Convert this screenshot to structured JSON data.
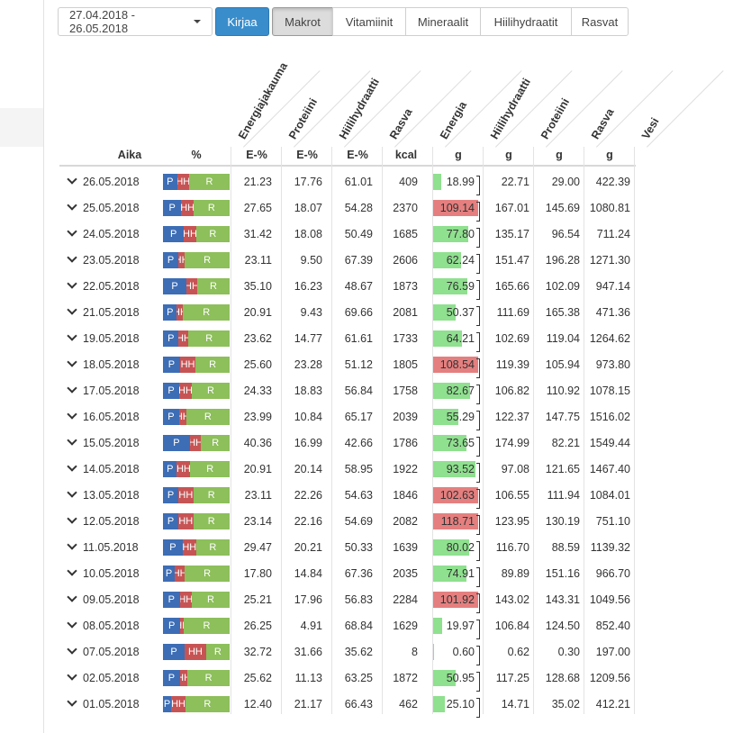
{
  "toolbar": {
    "date_range": "27.04.2018 - 26.05.2018",
    "log_button": "Kirjaa",
    "tabs": [
      "Makrot",
      "Vitamiinit",
      "Mineraalit",
      "Hiilihydraatit",
      "Rasvat"
    ],
    "active_tab": "Makrot"
  },
  "table": {
    "rotated_headers": [
      "Energiajakauma",
      "Proteiini",
      "Hiilihydraatti",
      "Rasva",
      "Energia",
      "Hiilihydraatti",
      "Proteiini",
      "Rasva",
      "Vesi"
    ],
    "units": [
      "Aika",
      "%",
      "E-%",
      "E-%",
      "E-%",
      "kcal",
      "g",
      "g",
      "g",
      "g",
      "g"
    ],
    "bar_labels": {
      "p": "P",
      "h": "HH",
      "r": "R"
    },
    "colors": {
      "protein": "#3d6db5",
      "carb": "#c75454",
      "fat": "#8dbf5b",
      "energy_ok": "#8fe08f",
      "energy_over": "#e57f7f"
    },
    "rows": [
      {
        "date": "26.05.2018",
        "p": "21.23",
        "h": "17.76",
        "r": "61.01",
        "kcal": "409",
        "energy": "18.99",
        "carb_g": "22.71",
        "protein_g": "29.00",
        "fat_g": "422.39",
        "split": [
          21.23,
          17.76,
          61.01
        ]
      },
      {
        "date": "25.05.2018",
        "p": "27.65",
        "h": "18.07",
        "r": "54.28",
        "kcal": "2370",
        "energy": "109.14",
        "carb_g": "167.01",
        "protein_g": "145.69",
        "fat_g": "1080.81",
        "split": [
          27.65,
          18.07,
          54.28
        ]
      },
      {
        "date": "24.05.2018",
        "p": "31.42",
        "h": "18.08",
        "r": "50.49",
        "kcal": "1685",
        "energy": "77.80",
        "carb_g": "135.17",
        "protein_g": "96.54",
        "fat_g": "711.24",
        "split": [
          31.42,
          18.08,
          50.49
        ]
      },
      {
        "date": "23.05.2018",
        "p": "23.11",
        "h": "9.50",
        "r": "67.39",
        "kcal": "2606",
        "energy": "62.24",
        "carb_g": "151.47",
        "protein_g": "196.28",
        "fat_g": "1271.30",
        "split": [
          23.11,
          9.5,
          67.39
        ]
      },
      {
        "date": "22.05.2018",
        "p": "35.10",
        "h": "16.23",
        "r": "48.67",
        "kcal": "1873",
        "energy": "76.59",
        "carb_g": "165.66",
        "protein_g": "102.09",
        "fat_g": "947.14",
        "split": [
          35.1,
          16.23,
          48.67
        ]
      },
      {
        "date": "21.05.2018",
        "p": "20.91",
        "h": "9.43",
        "r": "69.66",
        "kcal": "2081",
        "energy": "50.37",
        "carb_g": "111.69",
        "protein_g": "165.38",
        "fat_g": "471.36",
        "split": [
          20.91,
          9.43,
          69.66
        ]
      },
      {
        "date": "19.05.2018",
        "p": "23.62",
        "h": "14.77",
        "r": "61.61",
        "kcal": "1733",
        "energy": "64.21",
        "carb_g": "102.69",
        "protein_g": "119.04",
        "fat_g": "1264.62",
        "split": [
          23.62,
          14.77,
          61.61
        ]
      },
      {
        "date": "18.05.2018",
        "p": "25.60",
        "h": "23.28",
        "r": "51.12",
        "kcal": "1805",
        "energy": "108.54",
        "carb_g": "119.39",
        "protein_g": "105.94",
        "fat_g": "973.80",
        "split": [
          25.6,
          23.28,
          51.12
        ]
      },
      {
        "date": "17.05.2018",
        "p": "24.33",
        "h": "18.83",
        "r": "56.84",
        "kcal": "1758",
        "energy": "82.67",
        "carb_g": "106.82",
        "protein_g": "110.92",
        "fat_g": "1078.15",
        "split": [
          24.33,
          18.83,
          56.84
        ]
      },
      {
        "date": "16.05.2018",
        "p": "23.99",
        "h": "10.84",
        "r": "65.17",
        "kcal": "2039",
        "energy": "55.29",
        "carb_g": "122.37",
        "protein_g": "147.75",
        "fat_g": "1516.02",
        "split": [
          23.99,
          10.84,
          65.17
        ]
      },
      {
        "date": "15.05.2018",
        "p": "40.36",
        "h": "16.99",
        "r": "42.66",
        "kcal": "1786",
        "energy": "73.65",
        "carb_g": "174.99",
        "protein_g": "82.21",
        "fat_g": "1549.44",
        "split": [
          40.36,
          16.99,
          42.66
        ]
      },
      {
        "date": "14.05.2018",
        "p": "20.91",
        "h": "20.14",
        "r": "58.95",
        "kcal": "1922",
        "energy": "93.52",
        "carb_g": "97.08",
        "protein_g": "121.65",
        "fat_g": "1467.40",
        "split": [
          20.91,
          20.14,
          58.95
        ]
      },
      {
        "date": "13.05.2018",
        "p": "23.11",
        "h": "22.26",
        "r": "54.63",
        "kcal": "1846",
        "energy": "102.63",
        "carb_g": "106.55",
        "protein_g": "111.94",
        "fat_g": "1084.01",
        "split": [
          23.11,
          22.26,
          54.63
        ]
      },
      {
        "date": "12.05.2018",
        "p": "23.14",
        "h": "22.16",
        "r": "54.69",
        "kcal": "2082",
        "energy": "118.71",
        "carb_g": "123.95",
        "protein_g": "130.19",
        "fat_g": "751.10",
        "split": [
          23.14,
          22.16,
          54.69
        ]
      },
      {
        "date": "11.05.2018",
        "p": "29.47",
        "h": "20.21",
        "r": "50.33",
        "kcal": "1639",
        "energy": "80.02",
        "carb_g": "116.70",
        "protein_g": "88.59",
        "fat_g": "1139.32",
        "split": [
          29.47,
          20.21,
          50.33
        ]
      },
      {
        "date": "10.05.2018",
        "p": "17.80",
        "h": "14.84",
        "r": "67.36",
        "kcal": "2035",
        "energy": "74.91",
        "carb_g": "89.89",
        "protein_g": "151.16",
        "fat_g": "966.70",
        "split": [
          17.8,
          14.84,
          67.36
        ]
      },
      {
        "date": "09.05.2018",
        "p": "25.21",
        "h": "17.96",
        "r": "56.83",
        "kcal": "2284",
        "energy": "101.92",
        "carb_g": "143.02",
        "protein_g": "143.31",
        "fat_g": "1049.56",
        "split": [
          25.21,
          17.96,
          56.83
        ]
      },
      {
        "date": "08.05.2018",
        "p": "26.25",
        "h": "4.91",
        "r": "68.84",
        "kcal": "1629",
        "energy": "19.97",
        "carb_g": "106.84",
        "protein_g": "124.50",
        "fat_g": "852.40",
        "split": [
          26.25,
          4.91,
          68.84
        ]
      },
      {
        "date": "07.05.2018",
        "p": "32.72",
        "h": "31.66",
        "r": "35.62",
        "kcal": "8",
        "energy": "0.60",
        "carb_g": "0.62",
        "protein_g": "0.30",
        "fat_g": "197.00",
        "split": [
          32.72,
          31.66,
          35.62
        ]
      },
      {
        "date": "02.05.2018",
        "p": "25.62",
        "h": "11.13",
        "r": "63.25",
        "kcal": "1872",
        "energy": "50.95",
        "carb_g": "117.25",
        "protein_g": "128.68",
        "fat_g": "1209.56",
        "split": [
          25.62,
          11.13,
          63.25
        ]
      },
      {
        "date": "01.05.2018",
        "p": "12.40",
        "h": "21.17",
        "r": "66.43",
        "kcal": "462",
        "energy": "25.10",
        "carb_g": "14.71",
        "protein_g": "35.02",
        "fat_g": "412.21",
        "split": [
          12.4,
          21.17,
          66.43
        ]
      }
    ]
  }
}
